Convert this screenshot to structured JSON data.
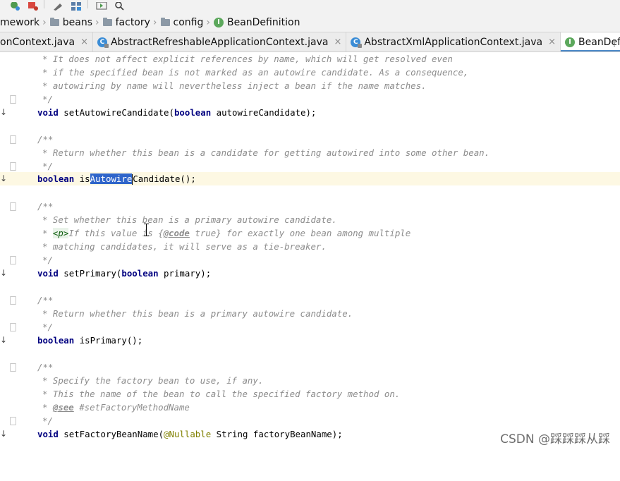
{
  "breadcrumb": {
    "items": [
      {
        "label": "mework",
        "icon": "none"
      },
      {
        "label": "beans",
        "icon": "folder-icon"
      },
      {
        "label": "factory",
        "icon": "folder-icon"
      },
      {
        "label": "config",
        "icon": "folder-icon"
      },
      {
        "label": "BeanDefinition",
        "icon": "interface-icon",
        "icon_letter": "I"
      }
    ]
  },
  "tabs": [
    {
      "label": "onContext.java",
      "active": false,
      "icon": "none"
    },
    {
      "label": "AbstractRefreshableApplicationContext.java",
      "active": false,
      "icon": "class-icon"
    },
    {
      "label": "AbstractXmlApplicationContext.java",
      "active": false,
      "icon": "class-icon"
    },
    {
      "label": "BeanDefinition.java",
      "active": true,
      "icon": "interface-icon"
    }
  ],
  "tab_close_glyph": "×",
  "editor": {
    "lines": {
      "l1": "* It does not affect explicit references by name, which will get resolved even",
      "l2": "* if the specified bean is not marked as an autowire candidate. As a consequence,",
      "l3": "* autowiring by name will nevertheless inject a bean if the name matches.",
      "l4": "*/",
      "l5_kw": "void",
      "l5_rest": " setAutowireCandidate(",
      "l5_kw2": "boolean",
      "l5_end": " autowireCandidate);",
      "l7": "/**",
      "l8": "* Return whether this bean is a candidate for getting autowired into some other bean.",
      "l9": "*/",
      "l10_kw": "boolean",
      "l10_a": " is",
      "l10_sel": "Autowire",
      "l10_b": "Candidate();",
      "l12": "/**",
      "l13": "* Set whether this bean is a primary autowire candidate.",
      "l14_a": "* ",
      "l14_tag": "<p>",
      "l14_b": "If this value is {",
      "l14_jd": "@code",
      "l14_c": " true} for exactly one bean among multiple",
      "l15": "* matching candidates, it will serve as a tie-breaker.",
      "l16": "*/",
      "l17_kw": "void",
      "l17_rest": " setPrimary(",
      "l17_kw2": "boolean",
      "l17_end": " primary);",
      "l19": "/**",
      "l20": "* Return whether this bean is a primary autowire candidate.",
      "l21": "*/",
      "l22_kw": "boolean",
      "l22_rest": " isPrimary();",
      "l24": "/**",
      "l25": "* Specify the factory bean to use, if any.",
      "l26": "* This the name of the bean to call the specified factory method on.",
      "l27_a": "* ",
      "l27_jd": "@see",
      "l27_b": " #setFactoryMethodName",
      "l28": "*/",
      "l29_kw": "void",
      "l29_rest": " setFactoryBeanName(",
      "l29_ann": "@Nullable",
      "l29_end": " String factoryBeanName);"
    }
  },
  "watermark": "CSDN @踩踩踩从踩",
  "colors": {
    "keyword": "#000080",
    "comment": "#8c8c8c",
    "selection": "#2f65ca",
    "current_line": "#fdf8e3",
    "tab_underline": "#4a88c7"
  }
}
